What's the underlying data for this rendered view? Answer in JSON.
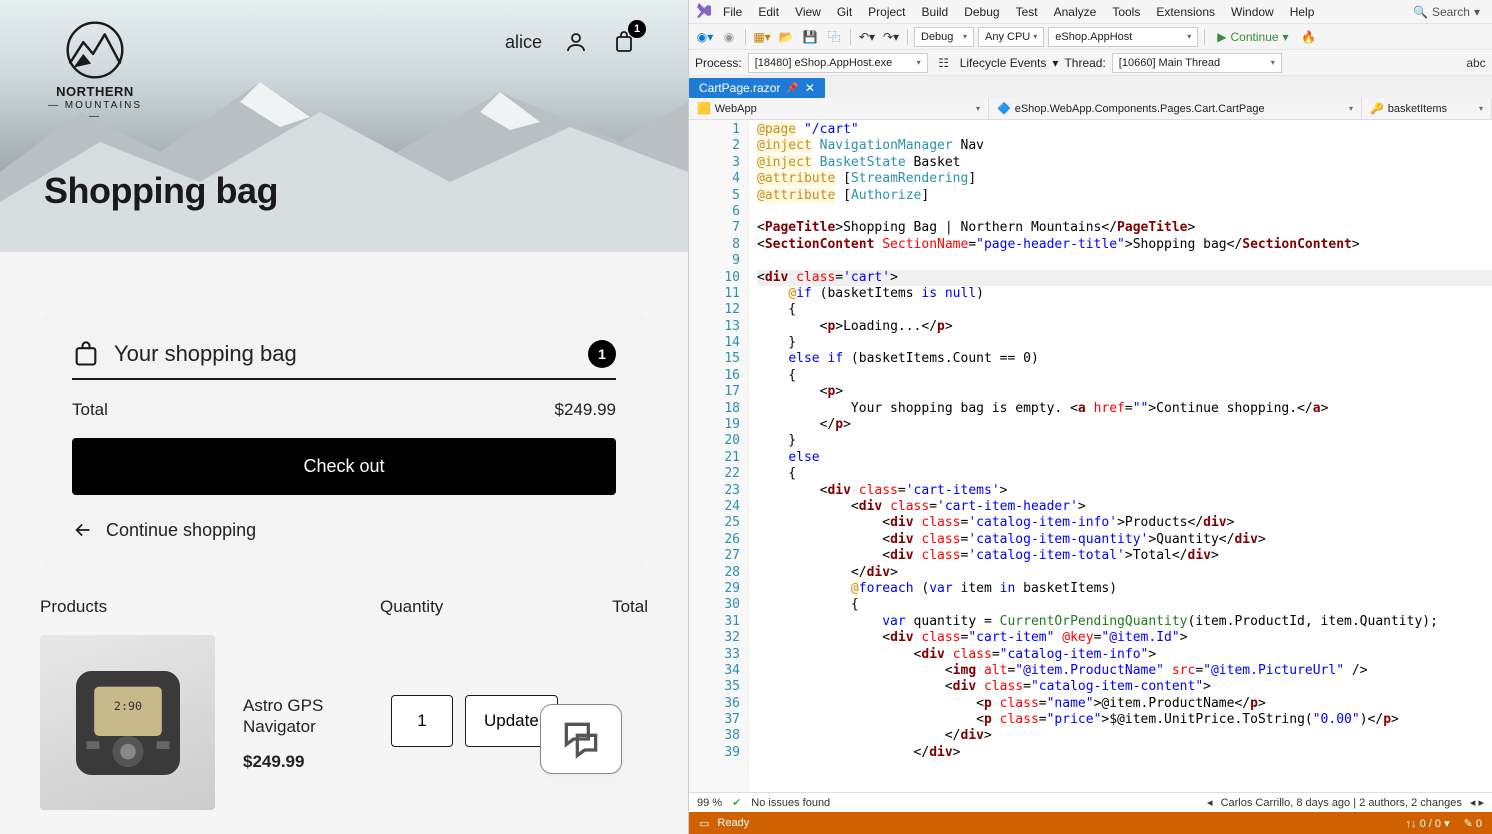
{
  "shop": {
    "brand_top": "NORTHERN",
    "brand_bottom": "— MOUNTAINS —",
    "username": "alice",
    "cart_badge": "1",
    "page_title": "Shopping bag",
    "bag_title": "Your shopping bag",
    "bag_count": "1",
    "total_label": "Total",
    "total_value": "$249.99",
    "checkout": "Check out",
    "continue": "Continue shopping",
    "cols": {
      "products": "Products",
      "quantity": "Quantity",
      "total": "Total"
    },
    "item": {
      "name": "Astro GPS Navigator",
      "price": "$249.99",
      "qty": "1",
      "update": "Update"
    }
  },
  "vs": {
    "menus": [
      "File",
      "Edit",
      "View",
      "Git",
      "Project",
      "Build",
      "Debug",
      "Test",
      "Analyze",
      "Tools",
      "Extensions",
      "Window",
      "Help"
    ],
    "search": "Search",
    "toolbar": {
      "config": "Debug",
      "platform": "Any CPU",
      "startup": "eShop.AppHost",
      "continue": "Continue"
    },
    "process_label": "Process:",
    "process_value": "[18480] eShop.AppHost.exe",
    "lifecycle": "Lifecycle Events",
    "thread_label": "Thread:",
    "thread_value": "[10660] Main Thread",
    "tab": "CartPage.razor",
    "nav": {
      "project": "WebApp",
      "class": "eShop.WebApp.Components.Pages.Cart.CartPage",
      "member": "basketItems"
    },
    "code": [
      {
        "n": 1,
        "h": "<span class='c-dir'>@page</span> <span class='c-str'>\"/cart\"</span>"
      },
      {
        "n": 2,
        "h": "<span class='c-dir'>@inject</span> <span class='c-type'>NavigationManager</span> Nav"
      },
      {
        "n": 3,
        "h": "<span class='c-dir'>@inject</span> <span class='c-type'>BasketState</span> Basket"
      },
      {
        "n": 4,
        "h": "<span class='c-dir'>@attribute</span> [<span class='c-type'>StreamRendering</span>]"
      },
      {
        "n": 5,
        "h": "<span class='c-dir'>@attribute</span> [<span class='c-type'>Authorize</span>]"
      },
      {
        "n": 6,
        "h": ""
      },
      {
        "n": 7,
        "h": "&lt;<span class='c-tag'>PageTitle</span>&gt;Shopping Bag | Northern Mountains&lt;/<span class='c-tag'>PageTitle</span>&gt;"
      },
      {
        "n": 8,
        "h": "&lt;<span class='c-tag'>SectionContent</span> <span class='c-attr'>SectionName</span>=<span class='c-str'>\"page-header-title\"</span>&gt;Shopping bag&lt;/<span class='c-tag'>SectionContent</span>&gt;"
      },
      {
        "n": 9,
        "h": ""
      },
      {
        "n": 10,
        "h": "&lt;<span class='c-tag'>div</span> <span class='c-attr'>class</span>=<span class='c-str'>'cart'</span>&gt;",
        "hl": true
      },
      {
        "n": 11,
        "h": "    <span class='c-at'>@</span><span class='c-kw'>if</span> (basketItems <span class='c-kw'>is</span> <span class='c-kw'>null</span>)"
      },
      {
        "n": 12,
        "h": "    {"
      },
      {
        "n": 13,
        "h": "        &lt;<span class='c-tag'>p</span>&gt;Loading...&lt;/<span class='c-tag'>p</span>&gt;"
      },
      {
        "n": 14,
        "h": "    }"
      },
      {
        "n": 15,
        "h": "    <span class='c-kw'>else</span> <span class='c-kw'>if</span> (basketItems.Count == 0)"
      },
      {
        "n": 16,
        "h": "    {"
      },
      {
        "n": 17,
        "h": "        &lt;<span class='c-tag'>p</span>&gt;"
      },
      {
        "n": 18,
        "h": "            Your shopping bag is empty. &lt;<span class='c-tag'>a</span> <span class='c-attr'>href</span>=<span class='c-str'>\"\"</span>&gt;Continue shopping.&lt;/<span class='c-tag'>a</span>&gt;"
      },
      {
        "n": 19,
        "h": "        &lt;/<span class='c-tag'>p</span>&gt;"
      },
      {
        "n": 20,
        "h": "    }"
      },
      {
        "n": 21,
        "h": "    <span class='c-kw'>else</span>"
      },
      {
        "n": 22,
        "h": "    {"
      },
      {
        "n": 23,
        "h": "        &lt;<span class='c-tag'>div</span> <span class='c-attr'>class</span>=<span class='c-str'>'cart-items'</span>&gt;"
      },
      {
        "n": 24,
        "h": "            &lt;<span class='c-tag'>div</span> <span class='c-attr'>class</span>=<span class='c-str'>'cart-item-header'</span>&gt;"
      },
      {
        "n": 25,
        "h": "                &lt;<span class='c-tag'>div</span> <span class='c-attr'>class</span>=<span class='c-str'>'catalog-item-info'</span>&gt;Products&lt;/<span class='c-tag'>div</span>&gt;"
      },
      {
        "n": 26,
        "h": "                &lt;<span class='c-tag'>div</span> <span class='c-attr'>class</span>=<span class='c-str'>'catalog-item-quantity'</span>&gt;Quantity&lt;/<span class='c-tag'>div</span>&gt;"
      },
      {
        "n": 27,
        "h": "                &lt;<span class='c-tag'>div</span> <span class='c-attr'>class</span>=<span class='c-str'>'catalog-item-total'</span>&gt;Total&lt;/<span class='c-tag'>div</span>&gt;"
      },
      {
        "n": 28,
        "h": "            &lt;/<span class='c-tag'>div</span>&gt;"
      },
      {
        "n": 29,
        "h": "            <span class='c-at'>@</span><span class='c-kw'>foreach</span> (<span class='c-kw'>var</span> item <span class='c-kw'>in</span> basketItems)"
      },
      {
        "n": 30,
        "h": "            {"
      },
      {
        "n": 31,
        "h": "                <span class='c-kw'>var</span> quantity = <span class='c-prop'>CurrentOrPendingQuantity</span>(item.ProductId, item.Quantity);"
      },
      {
        "n": 32,
        "h": "                &lt;<span class='c-tag'>div</span> <span class='c-attr'>class</span>=<span class='c-str'>\"cart-item\"</span> <span class='c-attr'>@key</span>=<span class='c-str'>\"@item.Id\"</span>&gt;"
      },
      {
        "n": 33,
        "h": "                    &lt;<span class='c-tag'>div</span> <span class='c-attr'>class</span>=<span class='c-str'>\"catalog-item-info\"</span>&gt;"
      },
      {
        "n": 34,
        "h": "                        &lt;<span class='c-tag'>img</span> <span class='c-attr'>alt</span>=<span class='c-str'>\"@item.ProductName\"</span> <span class='c-attr'>src</span>=<span class='c-str'>\"@item.PictureUrl\"</span> /&gt;"
      },
      {
        "n": 35,
        "h": "                        &lt;<span class='c-tag'>div</span> <span class='c-attr'>class</span>=<span class='c-str'>\"catalog-item-content\"</span>&gt;"
      },
      {
        "n": 36,
        "h": "                            &lt;<span class='c-tag'>p</span> <span class='c-attr'>class</span>=<span class='c-str'>\"name\"</span>&gt;@item.ProductName&lt;/<span class='c-tag'>p</span>&gt;"
      },
      {
        "n": 37,
        "h": "                            &lt;<span class='c-tag'>p</span> <span class='c-attr'>class</span>=<span class='c-str'>\"price\"</span>&gt;$@item.UnitPrice.ToString(<span class='c-str'>\"0.00\"</span>)&lt;/<span class='c-tag'>p</span>&gt;"
      },
      {
        "n": 38,
        "h": "                        &lt;/<span class='c-tag'>div</span>&gt;"
      },
      {
        "n": 39,
        "h": "                    &lt;/<span class='c-tag'>div</span>&gt;"
      }
    ],
    "status": {
      "zoom": "99 %",
      "issues": "No issues found",
      "blame": "Carlos Carrillo, 8 days ago | 2 authors, 2 changes"
    },
    "bottom": {
      "ready": "Ready",
      "nav": "0 / 0",
      "errors": "0"
    }
  }
}
